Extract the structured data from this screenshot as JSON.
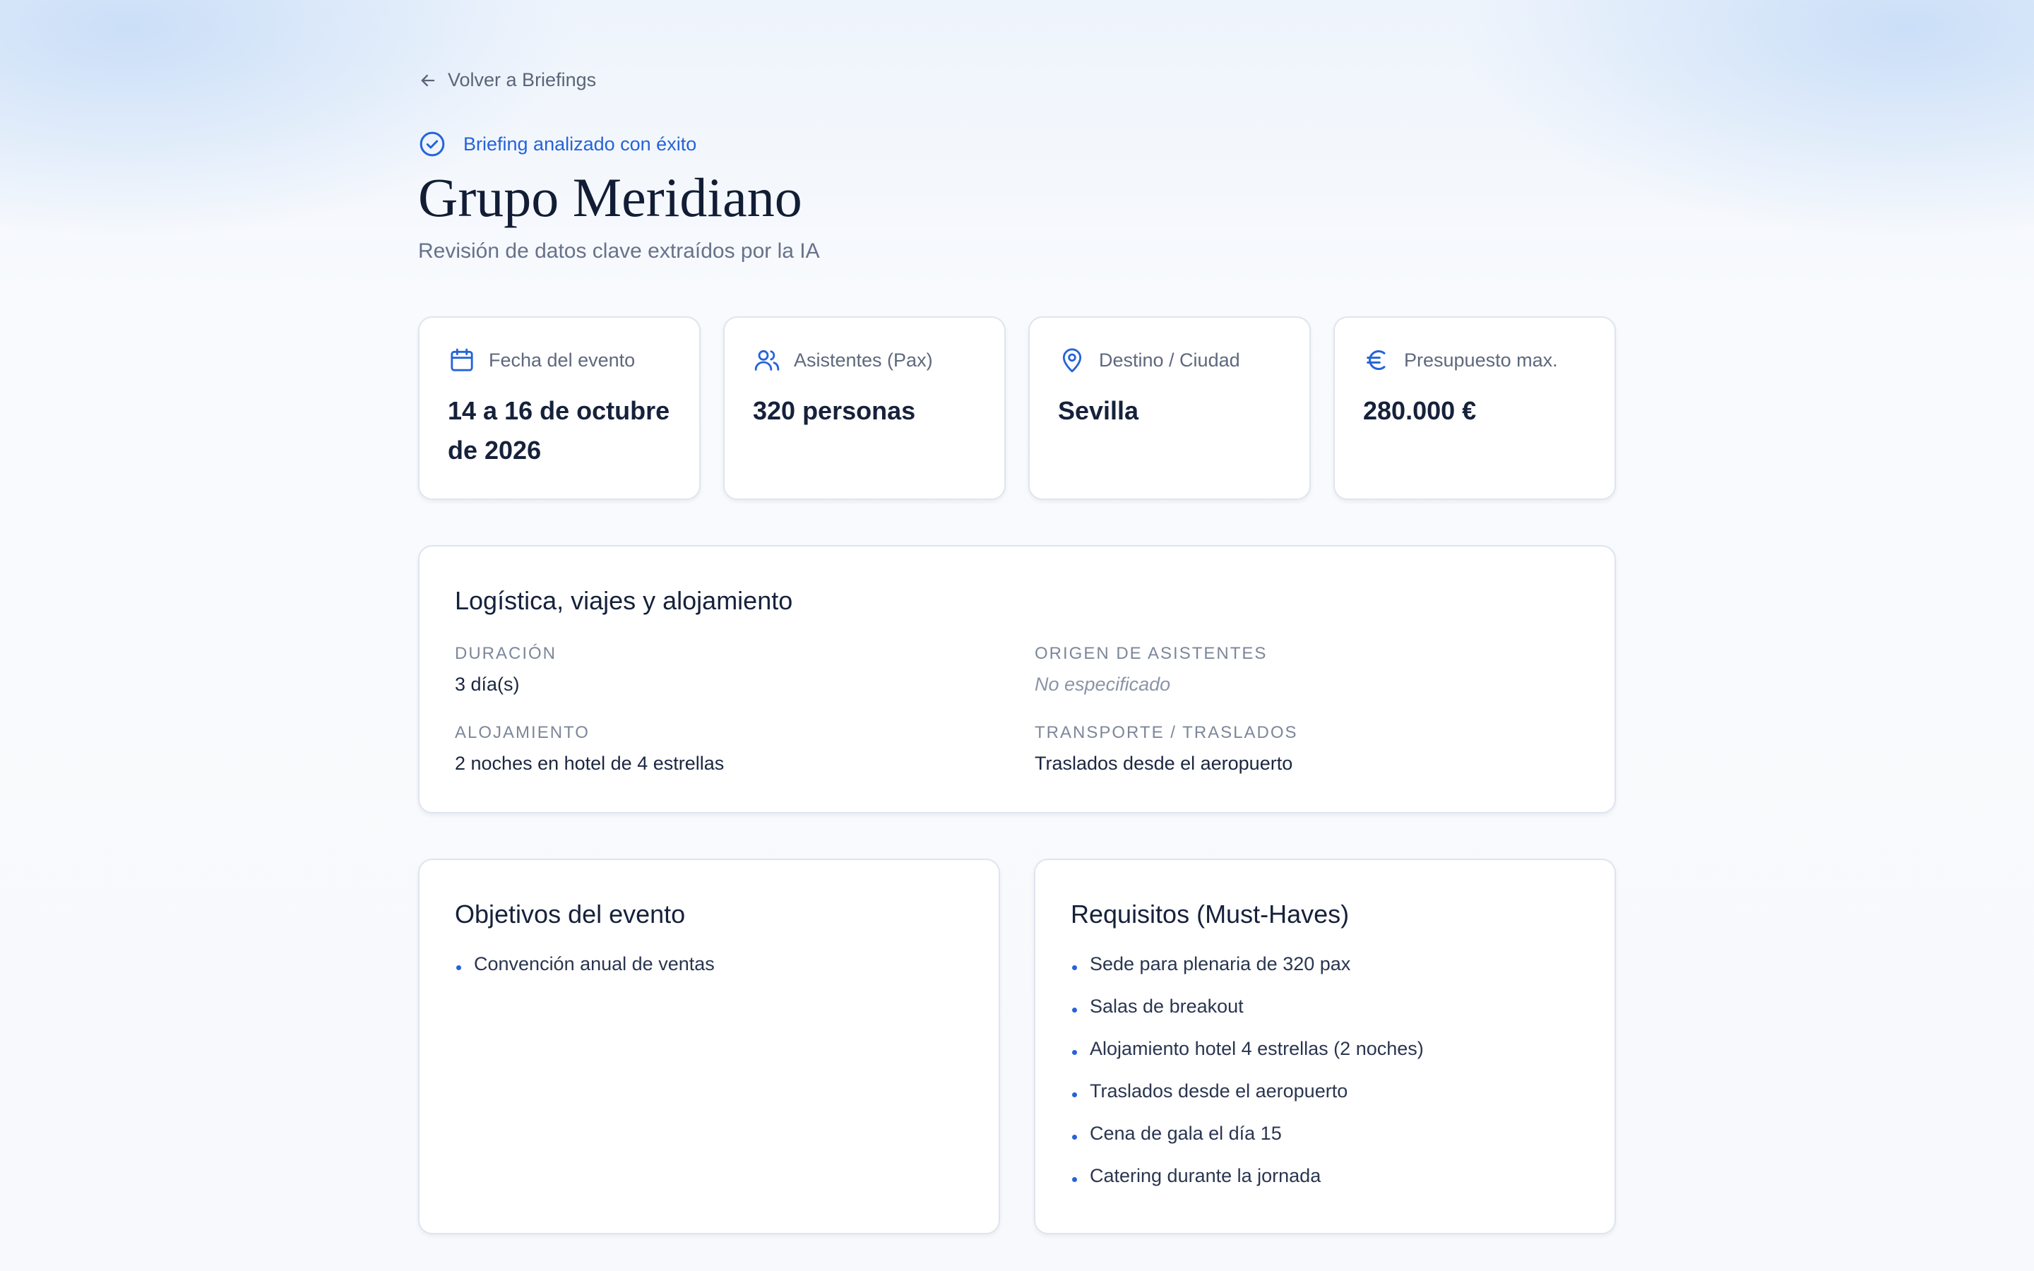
{
  "nav": {
    "back_label": "Volver a Briefings"
  },
  "header": {
    "status_text": "Briefing analizado con éxito",
    "title": "Grupo Meridiano",
    "subtitle": "Revisión de datos clave extraídos por la IA"
  },
  "stats": [
    {
      "icon": "calendar-icon",
      "label": "Fecha del evento",
      "value": "14 a 16 de octubre de 2026"
    },
    {
      "icon": "users-icon",
      "label": "Asistentes (Pax)",
      "value": "320 personas"
    },
    {
      "icon": "map-pin-icon",
      "label": "Destino / Ciudad",
      "value": "Sevilla"
    },
    {
      "icon": "euro-icon",
      "label": "Presupuesto max.",
      "value": "280.000 €"
    }
  ],
  "logistics": {
    "title": "Logística, viajes y alojamiento",
    "fields": [
      {
        "label": "Duración",
        "value": "3 día(s)"
      },
      {
        "label": "Origen de asistentes",
        "value": "No especificado"
      },
      {
        "label": "Alojamiento",
        "value": "2 noches en hotel de 4 estrellas"
      },
      {
        "label": "Transporte / Traslados",
        "value": "Traslados desde el aeropuerto"
      }
    ]
  },
  "objectives": {
    "title": "Objetivos del evento",
    "items": [
      "Convención anual de ventas"
    ]
  },
  "requirements": {
    "title": "Requisitos (Must-Haves)",
    "items": [
      "Sede para plenaria de 320 pax",
      "Salas de breakout",
      "Alojamiento hotel 4 estrellas (2 noches)",
      "Traslados desde el aeropuerto",
      "Cena de gala el día 15",
      "Catering durante la jornada"
    ]
  },
  "colors": {
    "accent": "#2563d9",
    "text": "#16213b",
    "muted": "#67728a",
    "border": "#dfe5ee"
  }
}
